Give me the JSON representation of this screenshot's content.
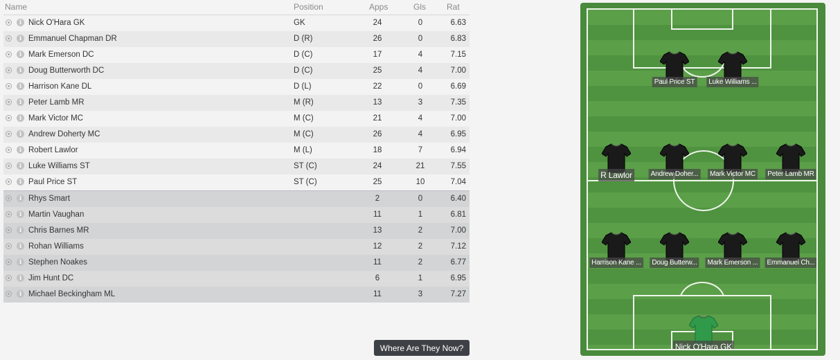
{
  "table": {
    "headers": {
      "name": "Name",
      "position": "Position",
      "apps": "Apps",
      "gls": "Gls",
      "rat": "Rat"
    },
    "starters": [
      {
        "name": "Nick O'Hara GK",
        "position": "GK",
        "apps": "24",
        "gls": "0",
        "rat": "6.63"
      },
      {
        "name": "Emmanuel Chapman DR",
        "position": "D (R)",
        "apps": "26",
        "gls": "0",
        "rat": "6.83"
      },
      {
        "name": "Mark Emerson DC",
        "position": "D (C)",
        "apps": "17",
        "gls": "4",
        "rat": "7.15"
      },
      {
        "name": "Doug Butterworth DC",
        "position": "D (C)",
        "apps": "25",
        "gls": "4",
        "rat": "7.00"
      },
      {
        "name": "Harrison Kane DL",
        "position": "D (L)",
        "apps": "22",
        "gls": "0",
        "rat": "6.69"
      },
      {
        "name": "Peter Lamb MR",
        "position": "M (R)",
        "apps": "13",
        "gls": "3",
        "rat": "7.35"
      },
      {
        "name": "Mark Victor MC",
        "position": "M (C)",
        "apps": "21",
        "gls": "4",
        "rat": "7.00"
      },
      {
        "name": "Andrew Doherty MC",
        "position": "M (C)",
        "apps": "26",
        "gls": "4",
        "rat": "6.95"
      },
      {
        "name": "Robert Lawlor",
        "position": "M (L)",
        "apps": "18",
        "gls": "7",
        "rat": "6.94"
      },
      {
        "name": "Luke Williams ST",
        "position": "ST (C)",
        "apps": "24",
        "gls": "21",
        "rat": "7.55"
      },
      {
        "name": "Paul Price ST",
        "position": "ST (C)",
        "apps": "25",
        "gls": "10",
        "rat": "7.04"
      }
    ],
    "subs": [
      {
        "name": "Rhys Smart",
        "position": "",
        "apps": "2",
        "gls": "0",
        "rat": "6.40"
      },
      {
        "name": "Martin Vaughan",
        "position": "",
        "apps": "11",
        "gls": "1",
        "rat": "6.81"
      },
      {
        "name": "Chris Barnes MR",
        "position": "",
        "apps": "13",
        "gls": "2",
        "rat": "7.00"
      },
      {
        "name": "Rohan Williams",
        "position": "",
        "apps": "12",
        "gls": "2",
        "rat": "7.12"
      },
      {
        "name": "Stephen Noakes",
        "position": "",
        "apps": "11",
        "gls": "2",
        "rat": "6.77"
      },
      {
        "name": "Jim Hunt DC",
        "position": "",
        "apps": "6",
        "gls": "1",
        "rat": "6.95"
      },
      {
        "name": "Michael Beckingham ML",
        "position": "",
        "apps": "11",
        "gls": "3",
        "rat": "7.27"
      }
    ],
    "row_icons": [
      "target-icon",
      "info-icon"
    ],
    "info_glyph": "i"
  },
  "where_button": {
    "label": "Where Are They Now?"
  },
  "pitch": {
    "colors": {
      "grass_light": "#5b9f49",
      "grass_dark": "#4f9240",
      "lines": "#eef5ea",
      "outfield_shirt": "#1a1a1a",
      "gk_shirt": "#2e9a4a"
    },
    "players": [
      {
        "label": "Paul Price ST",
        "role": "outfield"
      },
      {
        "label": "Luke Williams ...",
        "role": "outfield"
      },
      {
        "label": "R Lawlor",
        "role": "outfield",
        "big": true
      },
      {
        "label": "Andrew Doher...",
        "role": "outfield"
      },
      {
        "label": "Mark Victor MC",
        "role": "outfield"
      },
      {
        "label": "Peter Lamb MR",
        "role": "outfield"
      },
      {
        "label": "Harrison Kane ...",
        "role": "outfield"
      },
      {
        "label": "Doug Butterw...",
        "role": "outfield"
      },
      {
        "label": "Mark Emerson ...",
        "role": "outfield"
      },
      {
        "label": "Emmanuel Ch...",
        "role": "outfield"
      },
      {
        "label": "Nick O'Hara GK",
        "role": "goalkeeper",
        "big": true
      }
    ]
  }
}
